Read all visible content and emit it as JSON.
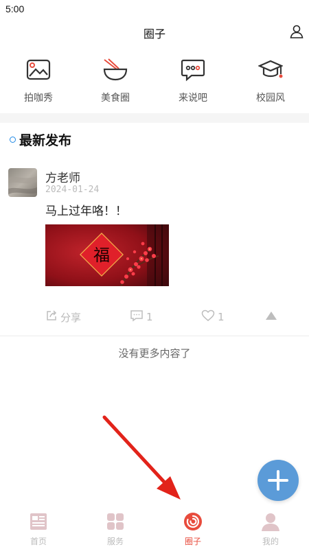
{
  "status_bar": {
    "time": "5:00"
  },
  "header": {
    "title": "圈子",
    "profile_icon": "user-icon"
  },
  "categories": [
    {
      "label": "拍咖秀",
      "icon": "photo-icon"
    },
    {
      "label": "美食圈",
      "icon": "food-bowl-icon"
    },
    {
      "label": "来说吧",
      "icon": "chat-bubble-icon"
    },
    {
      "label": "校园风",
      "icon": "graduation-cap-icon"
    }
  ],
  "section": {
    "title": "最新发布"
  },
  "post": {
    "author": "方老师",
    "date": "2024-01-24",
    "text": "马上过年咯！！",
    "image_char": "福",
    "share_label": "分享",
    "comment_count": "1",
    "like_count": "1"
  },
  "feed_end_text": "没有更多内容了",
  "tabs": [
    {
      "label": "首页",
      "icon": "news-icon",
      "active": false
    },
    {
      "label": "服务",
      "icon": "grid-icon",
      "active": false
    },
    {
      "label": "圈子",
      "icon": "circle-swirl-icon",
      "active": true
    },
    {
      "label": "我的",
      "icon": "person-icon",
      "active": false
    }
  ],
  "colors": {
    "accent_red": "#e84c3d",
    "fab_blue": "#5b9bd8",
    "section_dot_blue": "#1e88e5",
    "inactive_tab": "#e0c4c8"
  }
}
